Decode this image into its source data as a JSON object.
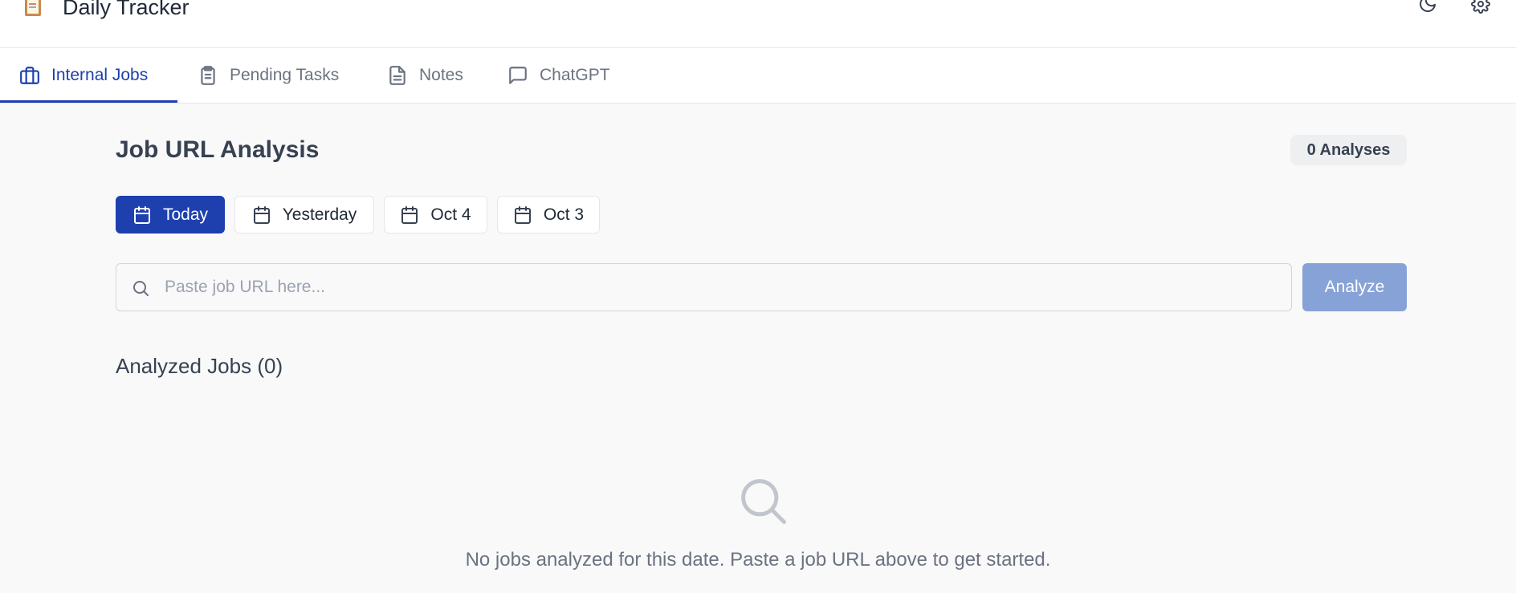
{
  "app": {
    "title": "Daily Tracker"
  },
  "header": {
    "icons": [
      "clipboard-logo-icon",
      "moon-icon",
      "gear-icon"
    ]
  },
  "tabs": [
    {
      "label": "Internal Jobs",
      "icon": "briefcase-icon",
      "active": true
    },
    {
      "label": "Pending Tasks",
      "icon": "clipboard-icon",
      "active": false
    },
    {
      "label": "Notes",
      "icon": "document-icon",
      "active": false
    },
    {
      "label": "ChatGPT",
      "icon": "chat-icon",
      "active": false
    }
  ],
  "main": {
    "title": "Job URL Analysis",
    "analyses_badge": "0 Analyses",
    "date_filters": [
      {
        "label": "Today",
        "active": true
      },
      {
        "label": "Yesterday",
        "active": false
      },
      {
        "label": "Oct 4",
        "active": false
      },
      {
        "label": "Oct 3",
        "active": false
      }
    ],
    "search": {
      "placeholder": "Paste job URL here...",
      "value": ""
    },
    "analyze_label": "Analyze",
    "analyzed_title": "Analyzed Jobs (0)",
    "empty_message": "No jobs analyzed for this date. Paste a job URL above to get started."
  },
  "colors": {
    "accent": "#1e40af",
    "accent_disabled": "#87a2d6",
    "background": "#f9f9fa",
    "text_muted": "#6b7280"
  }
}
